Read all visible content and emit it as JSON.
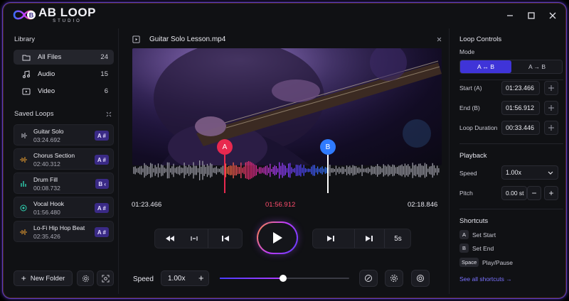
{
  "app": {
    "logo_main": "AB LOOP",
    "logo_sub": "STUDIO",
    "logo_badge": "B",
    "colors": {
      "accent": "#3f34d8",
      "marker_a": "#e8294f",
      "marker_b": "#2f7bff",
      "badge": "#3a2a86"
    }
  },
  "library": {
    "title": "Library",
    "items": [
      {
        "label": "All Files",
        "count": "24",
        "icon": "folder-icon"
      },
      {
        "label": "Audio",
        "count": "15",
        "icon": "music-note-icon"
      },
      {
        "label": "Video",
        "count": "6",
        "icon": "video-icon"
      }
    ]
  },
  "saved_loops": {
    "title": "Saved Loops",
    "items": [
      {
        "name": "Guitar Solo",
        "time": "03:24.692",
        "badge": "A #"
      },
      {
        "name": "Chorus Section",
        "time": "02:40.312",
        "badge": "A #"
      },
      {
        "name": "Drum Fill",
        "time": "00:08.732",
        "badge": "B ‹"
      },
      {
        "name": "Vocal Hook",
        "time": "01:56.480",
        "badge": "A #"
      },
      {
        "name": "Lo-Fi Hip Hop Beat",
        "time": "02:35.426",
        "badge": "A #"
      }
    ],
    "new_folder": "New Folder"
  },
  "player": {
    "file_name": "Guitar Solo Lesson.mp4",
    "marker_a": "A",
    "marker_b": "B",
    "time_start": "01:23.466",
    "time_current": "01:56.912",
    "time_total": "02:18.846",
    "skip_label": "5s",
    "speed_label": "Speed",
    "speed_value": "1.00x",
    "speed_slider_fraction": 0.49
  },
  "loop_controls": {
    "title": "Loop Controls",
    "mode_label": "Mode",
    "mode_ab": "A ↔ B",
    "mode_a_to_b": "A → B",
    "start_label": "Start (A)",
    "start_value": "01:23.466",
    "end_label": "End (B)",
    "end_value": "01:56.912",
    "duration_label": "Loop Duration",
    "duration_value": "00:33.446"
  },
  "playback": {
    "title": "Playback",
    "speed_label": "Speed",
    "speed_value": "1.00x",
    "pitch_label": "Pitch",
    "pitch_value": "0.00 st"
  },
  "shortcuts": {
    "title": "Shortcuts",
    "items": [
      {
        "key": "A",
        "action": "Set Start"
      },
      {
        "key": "B",
        "action": "Set End"
      },
      {
        "key": "Space",
        "action": "Play/Pause"
      }
    ],
    "see_all": "See all shortcuts →"
  }
}
